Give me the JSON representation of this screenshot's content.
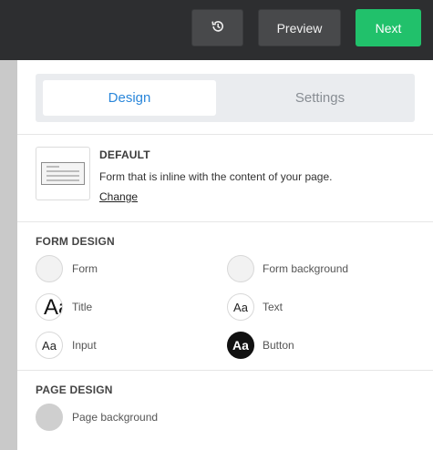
{
  "toolbar": {
    "history_icon": "history-icon",
    "preview_label": "Preview",
    "next_label": "Next",
    "accent_color": "#21c16b"
  },
  "tabs": [
    {
      "label": "Design",
      "active": true
    },
    {
      "label": "Settings",
      "active": false
    }
  ],
  "layout_style": {
    "title": "DEFAULT",
    "description": "Form that is inline with the content of your page.",
    "change_label": "Change"
  },
  "form_design": {
    "title": "FORM DESIGN",
    "options": [
      {
        "label": "Form",
        "swatch": "#f2f2f2"
      },
      {
        "label": "Form background",
        "swatch": "#f2f2f2"
      },
      {
        "label": "Title",
        "glyph": "Aa"
      },
      {
        "label": "Text",
        "glyph": "Aa"
      },
      {
        "label": "Input",
        "glyph": "Aa"
      },
      {
        "label": "Button",
        "glyph": "Aa",
        "swatch": "#111111"
      }
    ]
  },
  "page_design": {
    "title": "PAGE DESIGN",
    "options": [
      {
        "label": "Page background",
        "swatch": "#cfcfcf"
      }
    ]
  }
}
